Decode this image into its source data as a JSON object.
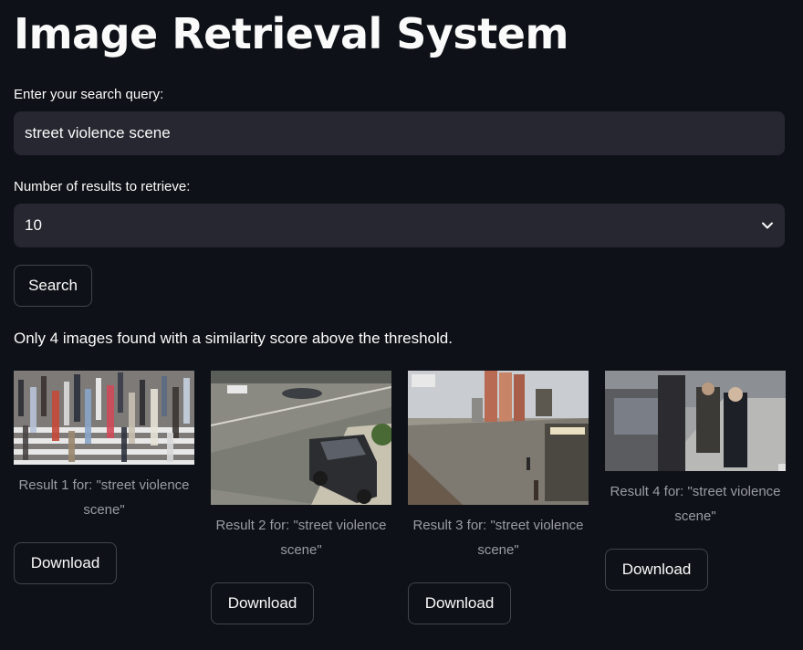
{
  "title": "Image Retrieval System",
  "query": {
    "label": "Enter your search query:",
    "value": "street violence scene"
  },
  "num_results": {
    "label": "Number of results to retrieve:",
    "selected": "10"
  },
  "search_button": "Search",
  "status_message": "Only 4 images found with a similarity score above the threshold.",
  "results": [
    {
      "caption": "Result 1 for: \"street violence scene\"",
      "download": "Download"
    },
    {
      "caption": "Result 2 for: \"street violence scene\"",
      "download": "Download"
    },
    {
      "caption": "Result 3 for: \"street violence scene\"",
      "download": "Download"
    },
    {
      "caption": "Result 4 for: \"street violence scene\"",
      "download": "Download"
    }
  ]
}
